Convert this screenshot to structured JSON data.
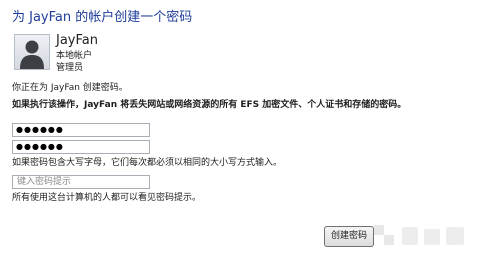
{
  "dialog": {
    "title": "为 JayFan 的帐户创建一个密码"
  },
  "account": {
    "name": "JayFan",
    "type": "本地帐户",
    "role": "管理员"
  },
  "info": {
    "creating": "你正在为 JayFan 创建密码。",
    "warning": "如果执行该操作，JayFan 将丢失网站或网络资源的所有 EFS 加密文件、个人证书和存储的密码。"
  },
  "form": {
    "password_value": "●●●●●●",
    "confirm_value": "●●●●●●",
    "case_note": "如果密码包含大写字母，它们每次都必须以相同的大小写方式输入。",
    "hint_placeholder": "键入密码提示",
    "hint_note": "所有使用这台计算机的人都可以看见密码提示。"
  },
  "buttons": {
    "create_label": "创建密码"
  },
  "colors": {
    "title": "#1f3d99",
    "field_border": "#a9aeb6"
  },
  "icons": {
    "avatar": "user-avatar-icon",
    "watermark": "watermark-logo-icon"
  }
}
